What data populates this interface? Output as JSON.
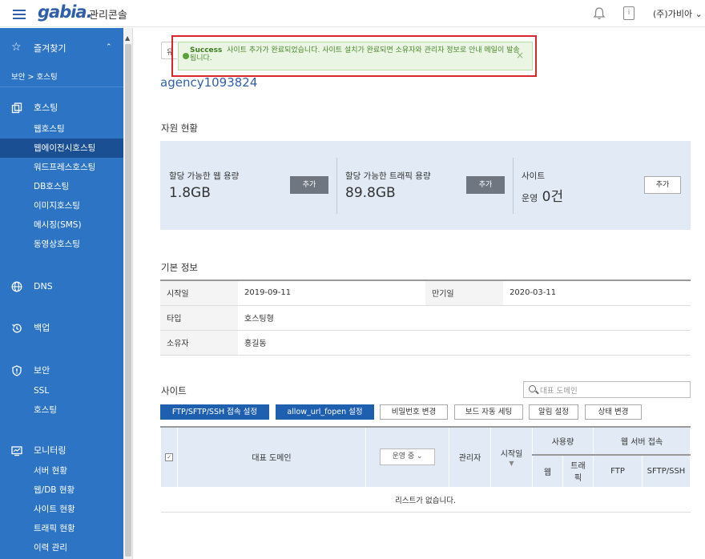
{
  "header": {
    "logo": "gabia.",
    "console": "관리콘솔",
    "company": "(주)가비아"
  },
  "sidebar": {
    "favorites": "즐겨찾기",
    "breadcrumb": "보안 > 호스팅",
    "hosting": "호스팅",
    "hosting_items": [
      "웹호스팅",
      "웹에이전시호스팅",
      "워드프레스호스팅",
      "DB호스팅",
      "이미지호스팅",
      "메시징(SMS)",
      "동영상호스팅"
    ],
    "dns": "DNS",
    "backup": "백업",
    "security": "보안",
    "security_items": [
      "SSL",
      "호스팅"
    ],
    "monitoring": "모니터링",
    "monitoring_items": [
      "서버 현황",
      "웹/DB 현황",
      "사이트 현황",
      "트래픽 현황",
      "이력 관리"
    ]
  },
  "toast": {
    "status": "Success",
    "message": "사이트 추가가 완료되었습니다. 사이트 설치가 완료되면 소유자와 관리자 정보로 안내 메일이 발송됩니다.",
    "close": "×"
  },
  "page": {
    "pill": "유",
    "title": "agency1093824"
  },
  "resources": {
    "title": "자원 현황",
    "web": {
      "label": "할당 가능한 웹 용량",
      "value": "1.8GB",
      "button": "추가"
    },
    "traffic": {
      "label": "할당 가능한 트래픽 용량",
      "value": "89.8GB",
      "button": "추가"
    },
    "site": {
      "label": "사이트",
      "prefix": "운영",
      "value": "0건",
      "button": "추가"
    }
  },
  "basic": {
    "title": "기본 정보",
    "start_label": "시작일",
    "start_value": "2019-09-11",
    "end_label": "만기일",
    "end_value": "2020-03-11",
    "type_label": "타입",
    "type_value": "호스팅형",
    "owner_label": "소유자",
    "owner_value": "홍길동"
  },
  "sites": {
    "title": "사이트",
    "search_placeholder": "대표 도메인",
    "buttons": [
      "FTP/SFTP/SSH 접속 설정",
      "allow_url_fopen 설정",
      "비밀번호 변경",
      "보드 자동 세팅",
      "알림 설정",
      "상태 변경"
    ],
    "headers": {
      "domain": "대표 도메인",
      "status_select": "운영 중",
      "admin": "관리자",
      "start": "시작일",
      "usage": "사용량",
      "web": "웹",
      "traffic": "트래픽",
      "web_server": "웹 서버 접속",
      "ftp": "FTP",
      "sftp": "SFTP/SSH"
    },
    "empty": "리스트가 없습니다."
  }
}
